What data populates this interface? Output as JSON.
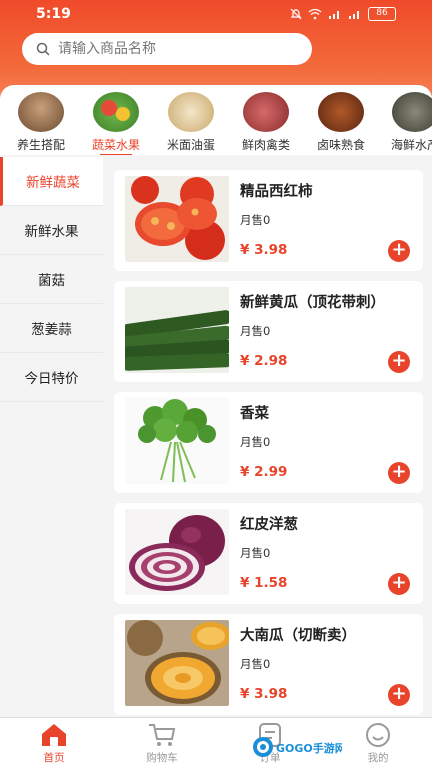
{
  "status_bar": {
    "time": "5:19",
    "battery": "86"
  },
  "search": {
    "placeholder": "请输入商品名称"
  },
  "categories": [
    {
      "label": "养生搭配",
      "active": false
    },
    {
      "label": "蔬菜水果",
      "active": true
    },
    {
      "label": "米面油蛋",
      "active": false
    },
    {
      "label": "鲜肉禽类",
      "active": false
    },
    {
      "label": "卤味熟食",
      "active": false
    },
    {
      "label": "海鲜水产",
      "active": false
    }
  ],
  "sidebar": {
    "items": [
      {
        "label": "新鲜蔬菜",
        "active": true
      },
      {
        "label": "新鲜水果",
        "active": false
      },
      {
        "label": "菌菇",
        "active": false
      },
      {
        "label": "葱姜蒜",
        "active": false
      },
      {
        "label": "今日特价",
        "active": false
      }
    ]
  },
  "products": [
    {
      "name": "精品西红柿",
      "sold": "月售0",
      "price": "¥ 3.98",
      "image": "tomato"
    },
    {
      "name": "新鲜黄瓜（顶花带刺）",
      "sold": "月售0",
      "price": "¥ 2.98",
      "image": "cucumber"
    },
    {
      "name": "香菜",
      "sold": "月售0",
      "price": "¥ 2.99",
      "image": "cilantro"
    },
    {
      "name": "红皮洋葱",
      "sold": "月售0",
      "price": "¥ 1.58",
      "image": "red-onion"
    },
    {
      "name": "大南瓜（切断卖）",
      "sold": "月售0",
      "price": "¥ 3.98",
      "image": "pumpkin"
    }
  ],
  "tabbar": {
    "items": [
      {
        "label": "首页",
        "icon": "home-icon",
        "active": true
      },
      {
        "label": "购物车",
        "icon": "cart-icon",
        "active": false
      },
      {
        "label": "订单",
        "icon": "order-icon",
        "active": false
      },
      {
        "label": "我的",
        "icon": "profile-icon",
        "active": false
      }
    ]
  },
  "watermark": {
    "text": "GOGO手游网"
  },
  "colors": {
    "accent": "#e8432b",
    "header_top": "#f04a2a",
    "header_bottom": "#f7a57f"
  }
}
